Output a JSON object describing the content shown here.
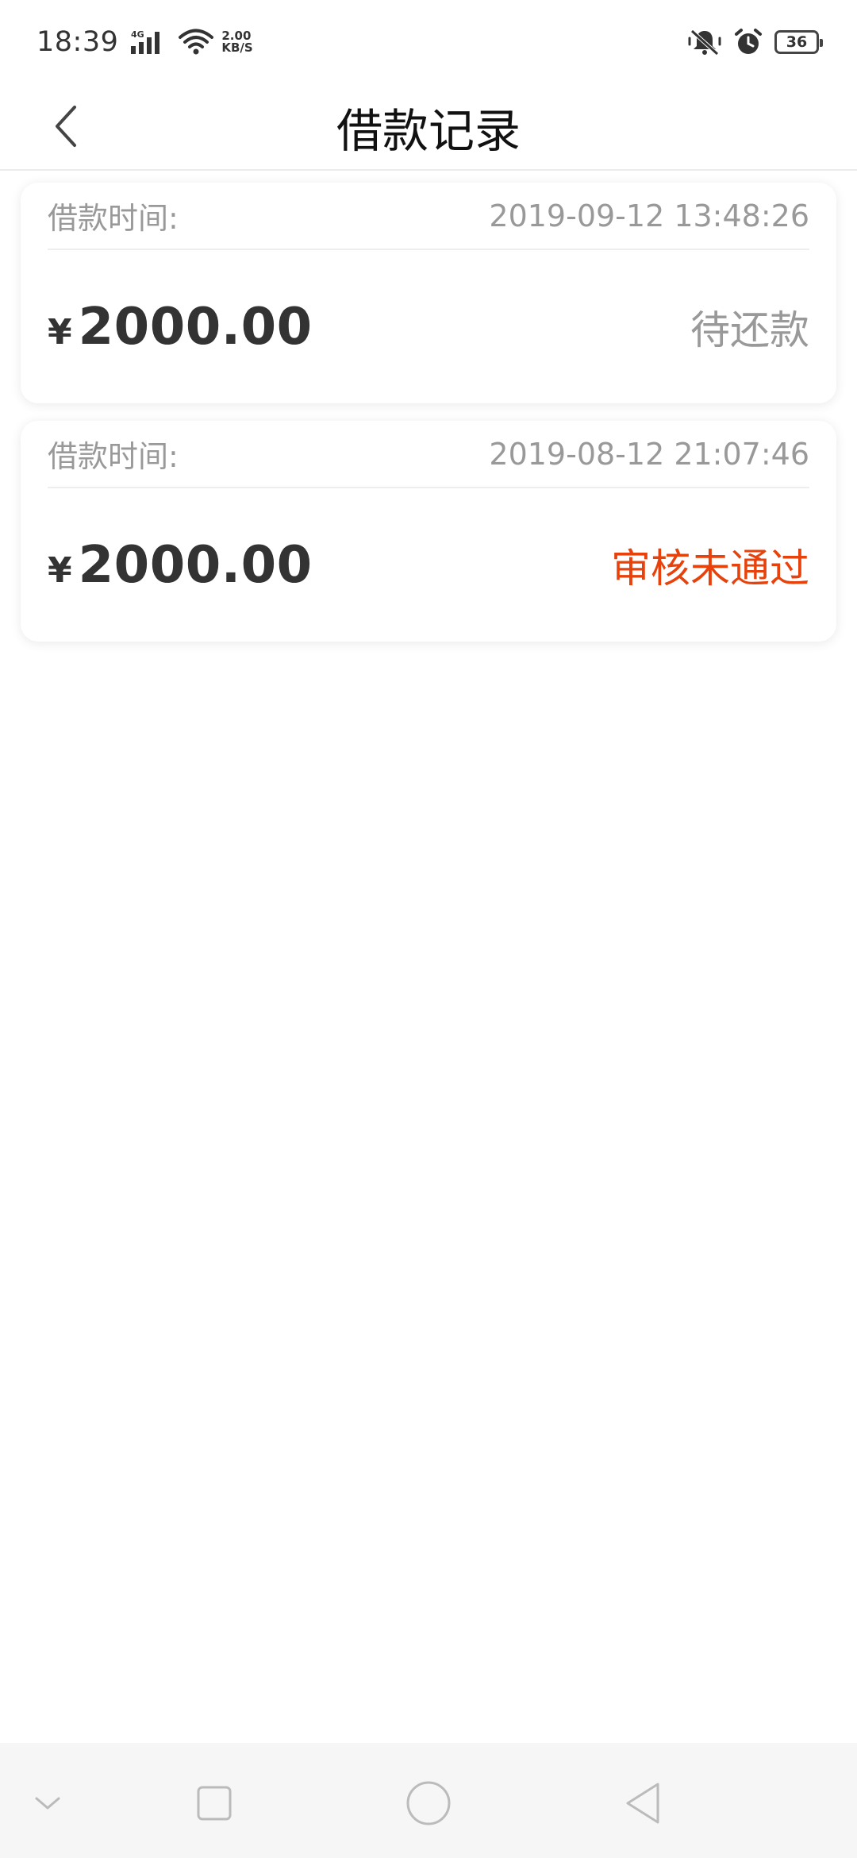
{
  "status_bar": {
    "time": "18:39",
    "network": "4G",
    "speed_value": "2.00",
    "speed_unit": "KB/S",
    "battery": "36",
    "icons": [
      "signal-icon",
      "wifi-icon",
      "mute-vibrate-icon",
      "alarm-icon",
      "battery-icon"
    ]
  },
  "header": {
    "title": "借款记录",
    "back_icon": "chevron-left-icon"
  },
  "records": [
    {
      "time_label": "借款时间:",
      "time": "2019-09-12 13:48:26",
      "currency": "¥",
      "amount": "2000.00",
      "status": "待还款",
      "status_color": "#999999"
    },
    {
      "time_label": "借款时间:",
      "time": "2019-08-12 21:07:46",
      "currency": "¥",
      "amount": "2000.00",
      "status": "审核未通过",
      "status_color": "#e8420c"
    }
  ],
  "nav_bar": {
    "icons": [
      "collapse-down-icon",
      "recent-apps-icon",
      "home-icon",
      "back-triangle-icon"
    ]
  }
}
